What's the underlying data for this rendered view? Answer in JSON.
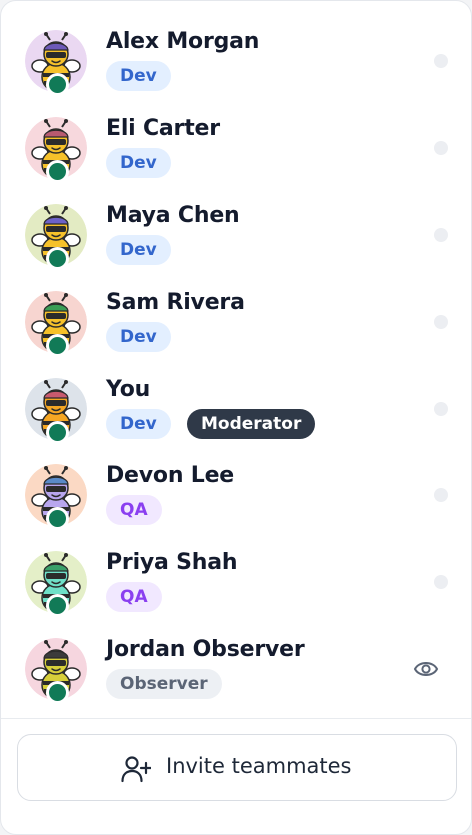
{
  "members": [
    {
      "name": "Alex Morgan",
      "role": "Dev",
      "role_kind": "dev",
      "extra_badge": null,
      "bg": "#ead8f2",
      "hat": "#6d5ab8",
      "body": "#f6c12a",
      "trailing": "dot"
    },
    {
      "name": "Eli Carter",
      "role": "Dev",
      "role_kind": "dev",
      "extra_badge": null,
      "bg": "#f7d8dd",
      "hat": "#b85a70",
      "body": "#f6c12a",
      "trailing": "dot"
    },
    {
      "name": "Maya Chen",
      "role": "Dev",
      "role_kind": "dev",
      "extra_badge": null,
      "bg": "#e3ebc3",
      "hat": "#6d62c8",
      "body": "#f6c12a",
      "trailing": "dot"
    },
    {
      "name": "Sam Rivera",
      "role": "Dev",
      "role_kind": "dev",
      "extra_badge": null,
      "bg": "#f7d5d0",
      "hat": "#3a9d55",
      "body": "#f6c12a",
      "trailing": "dot"
    },
    {
      "name": "You",
      "role": "Dev",
      "role_kind": "dev",
      "extra_badge": "Moderator",
      "bg": "#dde3ea",
      "hat": "#c85a6e",
      "body": "#f5a623",
      "trailing": "dot"
    },
    {
      "name": "Devon Lee",
      "role": "QA",
      "role_kind": "qa",
      "extra_badge": null,
      "bg": "#fbd9c4",
      "hat": "#5a8ac8",
      "body": "#b8a6ee",
      "trailing": "dot"
    },
    {
      "name": "Priya Shah",
      "role": "QA",
      "role_kind": "qa",
      "extra_badge": null,
      "bg": "#e4efc8",
      "hat": "#3aa06a",
      "body": "#6fe0c8",
      "trailing": "dot"
    },
    {
      "name": "Jordan Observer",
      "role": "Observer",
      "role_kind": "obs",
      "extra_badge": null,
      "bg": "#f6d6df",
      "hat": "#3b3b3b",
      "body": "#d7cf3a",
      "trailing": "eye"
    }
  ],
  "invite": {
    "label": "Invite teammates",
    "icon": "add-user-icon"
  },
  "colors": {
    "presence": "#117a57",
    "moderator_bg": "#2f3948"
  }
}
